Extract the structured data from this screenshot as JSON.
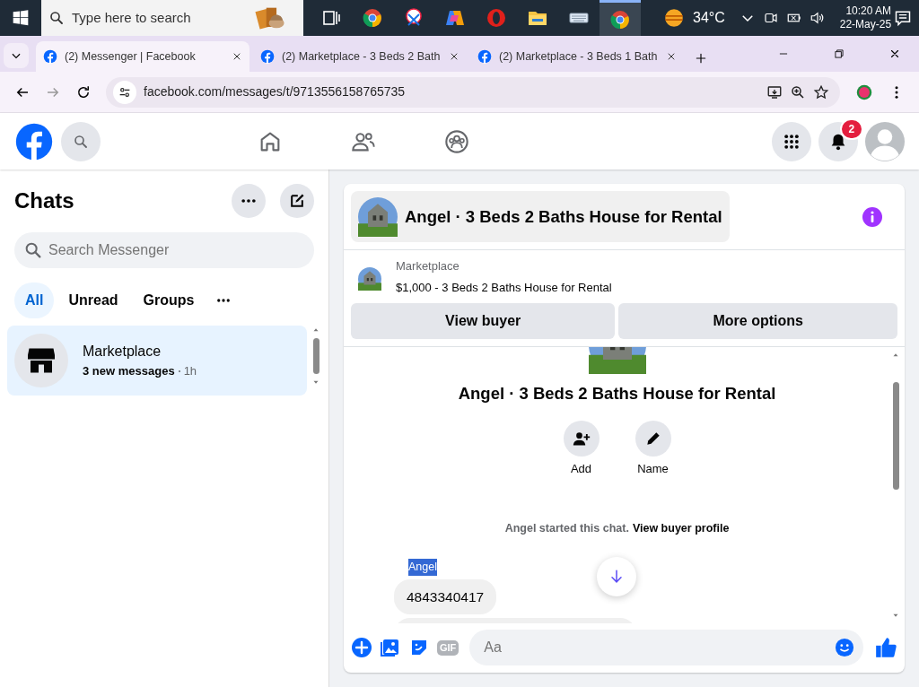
{
  "taskbar": {
    "search_placeholder": "Type here to search",
    "apps": [
      {
        "kind": "taskview",
        "selected": false
      },
      {
        "kind": "browser",
        "selected": false
      },
      {
        "kind": "snip",
        "selected": false
      },
      {
        "kind": "copilot",
        "selected": false
      },
      {
        "kind": "opera",
        "selected": false
      },
      {
        "kind": "folder",
        "selected": false
      },
      {
        "kind": "keyboard",
        "selected": false
      },
      {
        "kind": "browser",
        "selected": true
      }
    ],
    "temperature": "34°C",
    "time": "10:20 AM",
    "date": "22-May-25"
  },
  "browser": {
    "tabs": [
      {
        "title": "(2) Messenger | Facebook",
        "selected": true
      },
      {
        "title": "(2) Marketplace - 3 Beds 2 Bath",
        "selected": false
      },
      {
        "title": "(2) Marketplace - 3 Beds 1 Bath",
        "selected": false
      }
    ],
    "url": "facebook.com/messages/t/9713556158765735"
  },
  "header": {
    "notification_count": "2"
  },
  "chats": {
    "title": "Chats",
    "search_placeholder": "Search Messenger",
    "filters": [
      {
        "label": "All",
        "selected": true
      },
      {
        "label": "Unread",
        "selected": false
      },
      {
        "label": "Groups",
        "selected": false
      }
    ],
    "conversations": [
      {
        "name": "Marketplace",
        "preview": "3 new messages",
        "time": "1h",
        "selected": true
      }
    ]
  },
  "conversation": {
    "title": "Angel · 3 Beds 2 Baths House for Rental",
    "listing": {
      "source": "Marketplace",
      "title": "$1,000 - 3 Beds 2 Baths House for Rental"
    },
    "buttons": [
      "View buyer",
      "More options"
    ],
    "profile_title": "Angel · 3 Beds 2 Baths House for Rental",
    "actions": [
      {
        "kind": "add",
        "label": "Add"
      },
      {
        "kind": "name",
        "label": "Name"
      }
    ],
    "system_message": "Angel started this chat.",
    "system_link": "View buyer profile",
    "sender": {
      "name": "Angel",
      "highlighted": true
    },
    "messages": [
      "4843340417"
    ],
    "gif_label": "GIF",
    "composer_placeholder": "Aa"
  }
}
